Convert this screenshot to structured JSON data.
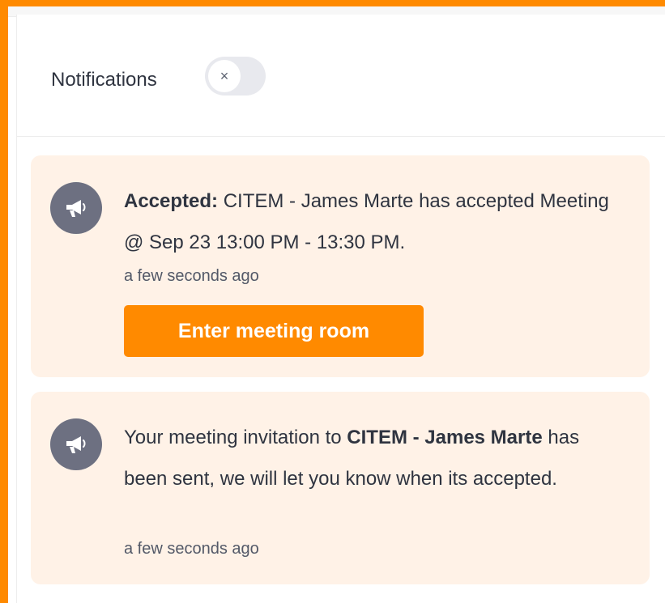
{
  "header": {
    "title": "Notifications",
    "close_symbol": "×"
  },
  "notifications": [
    {
      "prefix": "Accepted:",
      "text": "CITEM - James Marte has accepted Meeting @ Sep 23 13:00 PM - 13:30 PM.",
      "time": "a few seconds ago",
      "button_label": "Enter meeting room",
      "icon": "megaphone-icon"
    },
    {
      "text_before": "Your meeting invitation to",
      "highlight": "CITEM - James Marte",
      "text_after": "has been sent, we will let you know when its accepted.",
      "time": "a few seconds ago",
      "icon": "megaphone-icon"
    }
  ],
  "colors": {
    "accent": "#ff8a00",
    "card_background": "#fff2e7",
    "icon_background": "#6d7081",
    "text": "#2f3440"
  }
}
